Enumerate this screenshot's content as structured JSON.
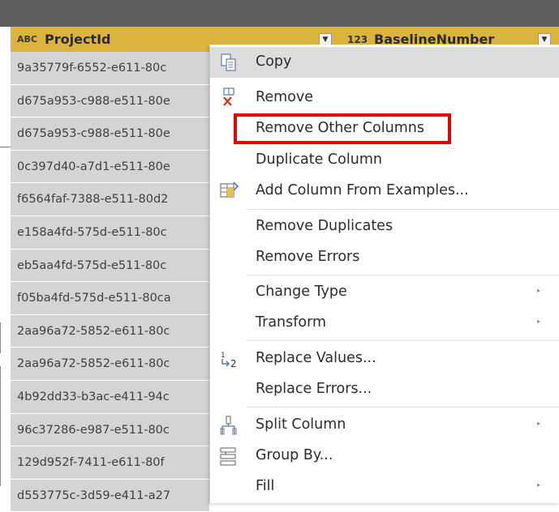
{
  "header": {
    "col1_type_icon": "ABC",
    "col1_title": "ProjectId",
    "col2_type_icon": "123",
    "col2_title": "BaselineNumber",
    "dropdown_icon": "chevron-down-icon"
  },
  "rows": [
    "9a35779f-6552-e611-80c",
    "d675a953-c988-e511-80e",
    "d675a953-c988-e511-80e",
    "0c397d40-a7d1-e511-80e",
    "f6564faf-7388-e511-80d2",
    "e158a4fd-575d-e511-80c",
    "eb5aa4fd-575d-e511-80c",
    "f05ba4fd-575d-e511-80ca",
    "2aa96a72-5852-e611-80c",
    "2aa96a72-5852-e611-80c",
    "4b92dd33-b3ac-e411-94c",
    "96c37286-e987-e511-80c",
    "129d952f-7411-e611-80f",
    "d553775c-3d59-e411-a27"
  ],
  "menu": {
    "copy": "Copy",
    "remove": "Remove",
    "remove_other_columns": "Remove Other Columns",
    "duplicate_column": "Duplicate Column",
    "add_column_from_examples": "Add Column From Examples...",
    "remove_duplicates": "Remove Duplicates",
    "remove_errors": "Remove Errors",
    "change_type": "Change Type",
    "transform": "Transform",
    "replace_values": "Replace Values...",
    "replace_errors": "Replace Errors...",
    "split_column": "Split Column",
    "group_by": "Group By...",
    "fill": "Fill",
    "submenu_arrow": "▸"
  },
  "colors": {
    "header_bg": "#dcb43d",
    "row_bg": "#d4d4d4",
    "highlight_bg": "#dddddd",
    "callout_red": "#e40000"
  }
}
